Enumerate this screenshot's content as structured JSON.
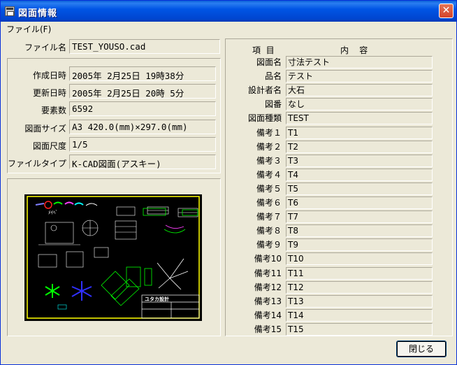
{
  "window": {
    "title": "図面情報",
    "close_glyph": "✕"
  },
  "menu": {
    "file": "ファイル(F)"
  },
  "file": {
    "filename_label": "ファイル名",
    "filename": "TEST_YOUSO.cad"
  },
  "info": {
    "created_label": "作成日時",
    "created": "2005年  2月25日  19時38分",
    "updated_label": "更新日時",
    "updated": "2005年  2月25日  20時 5分",
    "elements_label": "要素数",
    "elements": "6592",
    "size_label": "図面サイズ",
    "size": "A3  420.0(mm)×297.0(mm)",
    "scale_label": "図面尺度",
    "scale": "1/5",
    "type_label": "ファイルタイプ",
    "type": "K-CAD図面(アスキー)"
  },
  "preview": {
    "logo_text": "ユタカ設計"
  },
  "props": {
    "header_item": "項  目",
    "header_content": "内    容",
    "rows": [
      {
        "label": "図面名",
        "value": "寸法テスト"
      },
      {
        "label": "品名",
        "value": "テスト"
      },
      {
        "label": "設計者名",
        "value": "大石"
      },
      {
        "label": "図番",
        "value": "なし"
      },
      {
        "label": "図面種類",
        "value": "TEST"
      },
      {
        "label": "備考１",
        "value": "T1"
      },
      {
        "label": "備考２",
        "value": "T2"
      },
      {
        "label": "備考３",
        "value": "T3"
      },
      {
        "label": "備考４",
        "value": "T4"
      },
      {
        "label": "備考５",
        "value": "T5"
      },
      {
        "label": "備考６",
        "value": "T6"
      },
      {
        "label": "備考７",
        "value": "T7"
      },
      {
        "label": "備考８",
        "value": "T8"
      },
      {
        "label": "備考９",
        "value": "T9"
      },
      {
        "label": "備考10",
        "value": "T10"
      },
      {
        "label": "備考11",
        "value": "T11"
      },
      {
        "label": "備考12",
        "value": "T12"
      },
      {
        "label": "備考13",
        "value": "T13"
      },
      {
        "label": "備考14",
        "value": "T14"
      },
      {
        "label": "備考15",
        "value": "T15"
      }
    ]
  },
  "buttons": {
    "close": "閉じる"
  }
}
